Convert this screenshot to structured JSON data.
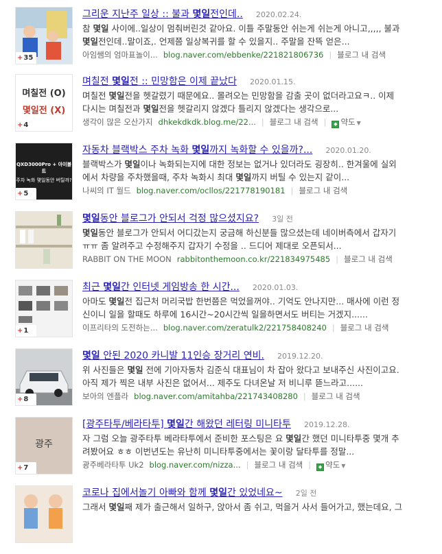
{
  "results": [
    {
      "title_pre": "그리운 지난주 일상 :: 불과 ",
      "title_kw": "몇일",
      "title_post": "전인데..",
      "date": "2020.02.24.",
      "line1_pre": "참 ",
      "line1_kw": "몇일",
      "line1_post": " 사이에..일상이 멈춰버린것 같아요. 이틀 주말동안 쉬는게 쉬는게 아니고,,,,, 불과",
      "line2_pre": "",
      "line2_kw": "몇일",
      "line2_post": "전인데..말이죠,. 언제쯤 일상복귀를 할 수 있을지.. 주말을 잔뜩 얻은...",
      "blog": "아임쌤의 엄마표놀이...",
      "url": "blog.naver.com/ebbenke/221821806736",
      "search": "블로그 내 검색",
      "map": "",
      "count": "35"
    },
    {
      "title_pre": "며칠전 ",
      "title_kw": "몇일",
      "title_post": "전 :: 민망함은 이제 끝났다",
      "date": "2020.01.15.",
      "line1_pre": "며칠전 ",
      "line1_kw": "몇일",
      "line1_post": "전을 헷갈렸기 때문에요.. 몰려오는 민망함을 감출 곳이 없더라고요ㅋ.. 이제",
      "line2_pre": "다시는 며칠전과 ",
      "line2_kw": "몇일",
      "line2_post": "전을 헷갈리지 않겠다 틀리지 않겠다는 생각으로...",
      "blog": "생각이 많은 오산가지",
      "url": "dhkekdkdk.blog.me/22...",
      "search": "블로그 내 검색",
      "map": "약도",
      "count": "4",
      "thumb_line1": "며칠전 (O)",
      "thumb_line2": "몇일전 (X)"
    },
    {
      "title_pre": "자동차 블랙박스 주차 녹화 ",
      "title_kw": "몇일",
      "title_post": "까지 녹화할 수 있을까?...",
      "date": "2020.01.20.",
      "line1_pre": "블랙박스가 ",
      "line1_kw": "몇일",
      "line1_post": "이나 녹화되는지에 대한 정보는 없거나 있더라도 굉장히.. 한겨울에 실외",
      "line2_pre": "에서 차량을 주차했을때, 주차 녹화시 최대 ",
      "line2_kw": "몇일",
      "line2_post": "까지 버틸 수 있는지 같이...",
      "blog": "나씨의 IT 월드",
      "url": "blog.naver.com/ocllos/221778190181",
      "search": "블로그 내 검색",
      "map": "",
      "count": "5",
      "thumb_line1": "QXD3000Pro + 아이볼트",
      "thumb_line2": "주차 녹화 몇일동안 버틸까?"
    },
    {
      "title_pre": "",
      "title_kw": "몇일",
      "title_post": "동안 블로그가 안되서 걱정 많으셨지요?",
      "date": "3일 전",
      "line1_pre": "",
      "line1_kw": "몇일",
      "line1_post": "동안 블로그가 안되서 어디갔는지 궁금해 하신분들 많으셨는데 네이버측에서 갑자기",
      "line2_pre": "ㅠㅠ 좀 알려주고 수정해주지 갑자기 수정을 .. 드디어 제대로 오픈되서...",
      "line2_kw": "",
      "line2_post": "",
      "blog": "RABBIT ON THE MOON",
      "url": "rabbitonthemoon.co.kr/221834975485",
      "search": "블로그 내 검색",
      "map": "",
      "count": ""
    },
    {
      "title_pre": "최근 ",
      "title_kw": "몇일",
      "title_post": "간 인터넷 게임방송 한 시간...",
      "date": "2020.01.03.",
      "line1_pre": "아마도 ",
      "line1_kw": "몇일",
      "line1_post": "전 집근처 머리국밥 한번쯤은 먹었을꺼야.. 기억도 안나지만... 매사에 이런 정",
      "line2_pre": "신이니 일을 할때도 하루에 16시간~20시간씩 일을하면서도 버티는 거겠지......",
      "line2_kw": "",
      "line2_post": "",
      "blog": "이프리타의 도전하는...",
      "url": "blog.naver.com/zeratulk2/221758408240",
      "search": "블로그 내 검색",
      "map": "",
      "count": "1"
    },
    {
      "title_pre": "",
      "title_kw": "몇일",
      "title_post": " 안된 2020 카니발 11인승 장거리 연비.",
      "date": "2019.12.20.",
      "line1_pre": "위 사진들은 ",
      "line1_kw": "몇일",
      "line1_post": " 전에 기아자동차 김준식 대표님이 차 잡아 왔다고 보내주신 사진이고요.",
      "line2_pre": "아직 제가 찍은 내부 사진은 없어서... 제주도 다녀온날 저 비니루 뜯느라고......",
      "line2_kw": "",
      "line2_post": "",
      "blog": "보아의 엔플라",
      "url": "blog.naver.com/amitahba/221743408280",
      "search": "블로그 내 검색",
      "map": "",
      "count": "8"
    },
    {
      "title_pre": "[광주타투/베라타투] ",
      "title_kw": "몇일",
      "title_post": "간 해왔던 레터링 미니타투",
      "date": "2019.12.28.",
      "line1_pre": "자 그럼 오늘 광주타투 베라타투에서 준비한 포스팅은 요 ",
      "line1_kw": "몇일",
      "line1_post": "간 했던 미니타투중 몇개 추",
      "line2_pre": "려봤어요 ㅎㅎ 이번년도는 유난히 미니타투중에서는 꽃이랑 달타투를 정말...",
      "line2_kw": "",
      "line2_post": "",
      "blog": "광주베라타투 Uk2",
      "url": "blog.naver.com/nizza...",
      "search": "블로그 내 검색",
      "map": "약도",
      "count": "7",
      "thumb_line1": "광주",
      "thumb_line2": ""
    },
    {
      "title_pre": "코로나 집에서놀기 아빠와 함께 ",
      "title_kw": "몇일",
      "title_post": "간 있었네요~",
      "date": "2일 전",
      "line1_pre": "그래서 ",
      "line1_kw": "몇일",
      "line1_post": "째 제가 출근해서 일하구, 앉아서 좀 쉬고, 먹을거 사서 들어가고, 했는데요, 그",
      "line2_pre": "",
      "line2_kw": "",
      "line2_post": "",
      "blog": "",
      "url": "",
      "search": "",
      "map": "",
      "count": ""
    }
  ]
}
